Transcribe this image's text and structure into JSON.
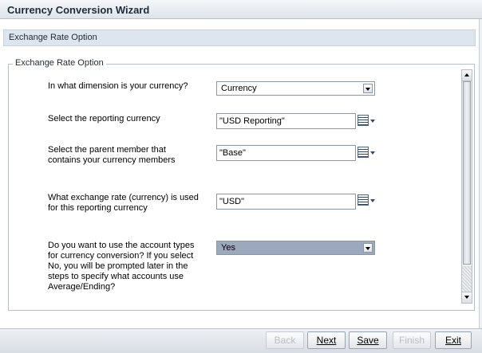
{
  "window": {
    "title": "Currency Conversion Wizard"
  },
  "section": {
    "header": "Exchange Rate Option",
    "legend": "Exchange Rate Option"
  },
  "questions": {
    "dimension": {
      "label": "In what dimension is your currency?",
      "value": "Currency"
    },
    "reporting": {
      "label": "Select the reporting currency",
      "value": "\"USD Reporting\""
    },
    "parent": {
      "label_line1": "Select the parent member that",
      "label_line2": "contains your currency members",
      "value": "\"Base\""
    },
    "rate": {
      "label_line1": "What exchange rate (currency) is used",
      "label_line2": "for this reporting currency",
      "value": "\"USD\""
    },
    "account_types": {
      "label_lines": [
        "Do you want to use the account types",
        "for currency conversion? If you select",
        "No, you will be prompted later in the",
        "steps to specify what accounts use",
        "Average/Ending?"
      ],
      "value": "Yes"
    }
  },
  "footer": {
    "back": "Back",
    "next": "Next",
    "save": "Save",
    "finish": "Finish",
    "exit": "Exit"
  }
}
